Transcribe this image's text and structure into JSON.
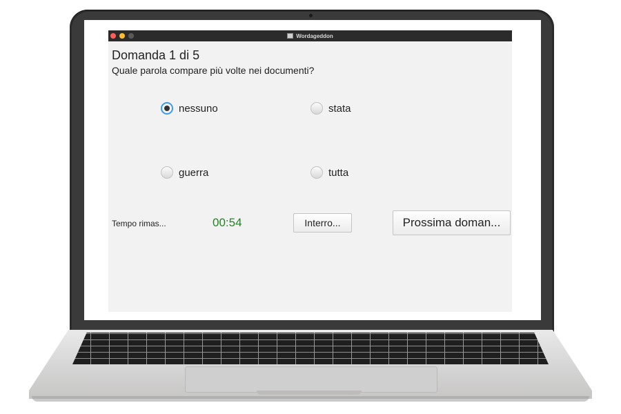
{
  "window": {
    "title": "Wordageddon"
  },
  "question": {
    "header": "Domanda 1 di 5",
    "text": "Quale parola compare più volte nei documenti?",
    "options": [
      {
        "label": "nessuno",
        "selected": true
      },
      {
        "label": "stata",
        "selected": false
      },
      {
        "label": "guerra",
        "selected": false
      },
      {
        "label": "tutta",
        "selected": false
      }
    ]
  },
  "timer": {
    "label": "Tempo rimas...",
    "value": "00:54",
    "color": "#1a8a1a"
  },
  "buttons": {
    "stop": "Interro...",
    "next": "Prossima doman..."
  },
  "colors": {
    "titlebar": "#2b2b2b",
    "selection_ring": "#3d9be9",
    "window_bg": "#f2f2f2"
  }
}
